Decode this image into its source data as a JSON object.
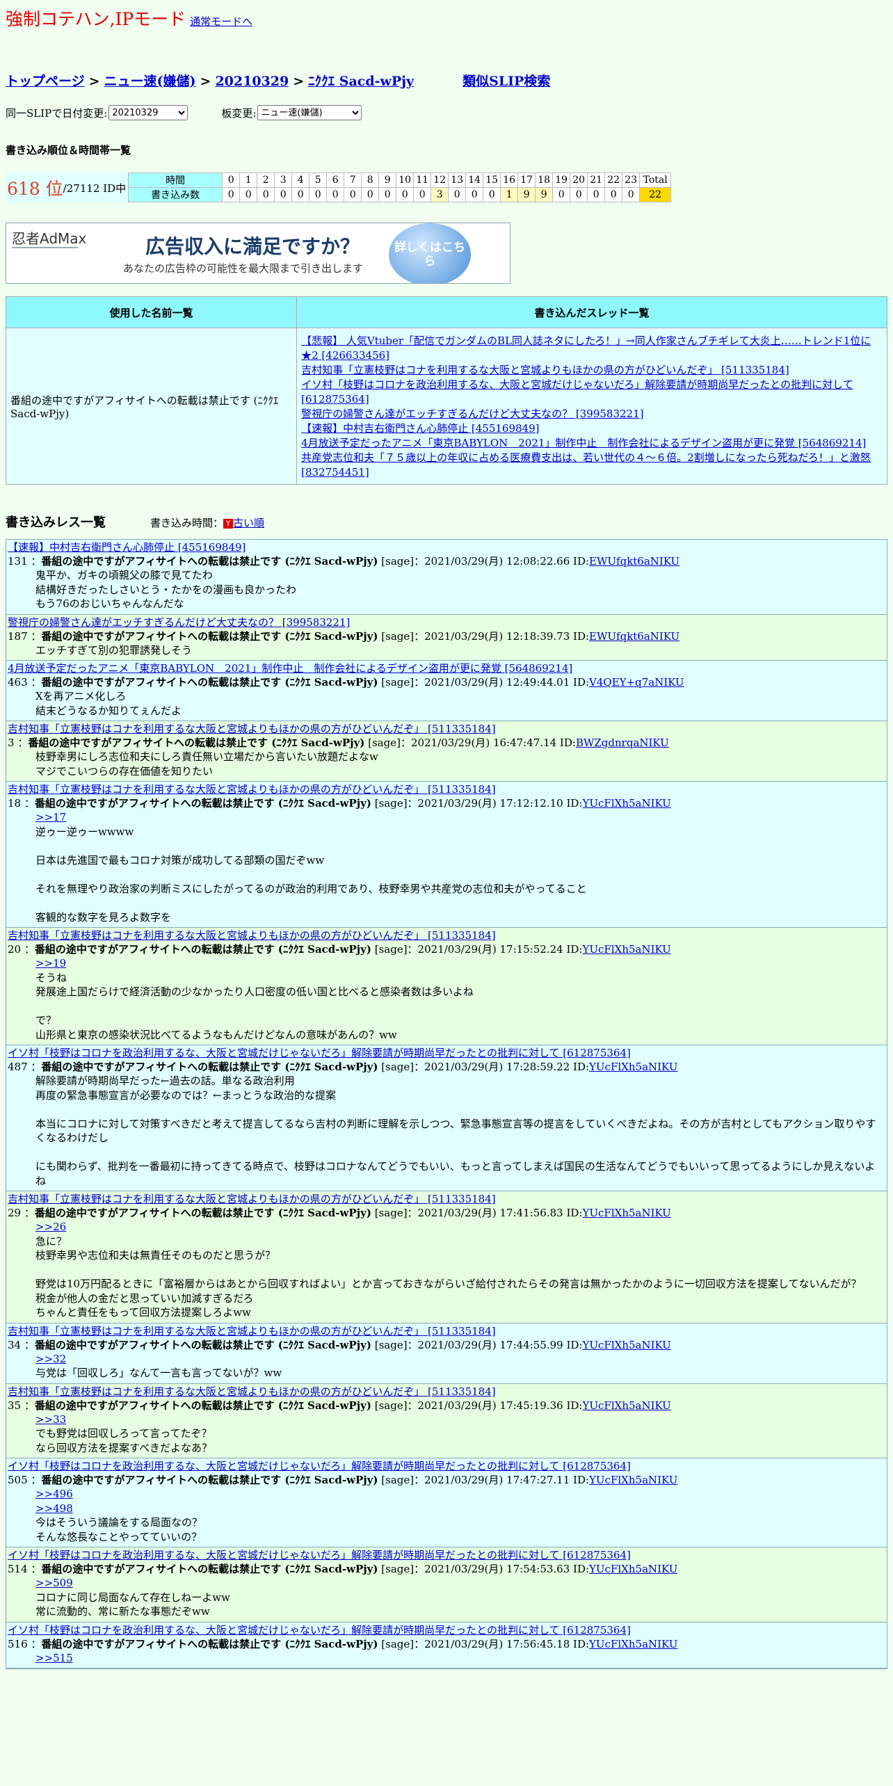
{
  "header": {
    "mode_title": "強制コテハン,IPモード",
    "normal_mode_link": "通常モードへ"
  },
  "breadcrumb": {
    "top": "トップページ",
    "board": "ニュー速(嫌儲)",
    "date": "20210329",
    "slip": "ﾆｸｸｴ Sacd-wPjy",
    "similar": "類似SLIP検索",
    "sep": ">"
  },
  "selectors": {
    "date_label": "同一SLIPで日付変更:",
    "date_value": "20210329",
    "board_label": "板変更:",
    "board_value": "ニュー速(嫌儲)"
  },
  "ranking": {
    "heading": "書き込み順位＆時間帯一覧",
    "rank": "618 位",
    "total_ids": "/27112 ID中",
    "time_label": "時間",
    "count_label": "書き込み数",
    "hours": [
      "0",
      "1",
      "2",
      "3",
      "4",
      "5",
      "6",
      "7",
      "8",
      "9",
      "10",
      "11",
      "12",
      "13",
      "14",
      "15",
      "16",
      "17",
      "18",
      "19",
      "20",
      "21",
      "22",
      "23"
    ],
    "counts": [
      "0",
      "0",
      "0",
      "0",
      "0",
      "0",
      "0",
      "0",
      "0",
      "0",
      "0",
      "0",
      "3",
      "0",
      "0",
      "0",
      "1",
      "9",
      "9",
      "0",
      "0",
      "0",
      "0",
      "0"
    ],
    "total_label": "Total",
    "total_value": "22"
  },
  "ad": {
    "logo": "忍者AdMax",
    "main": "広告収入に満足ですか？",
    "sub": "あなたの広告枠の可能性を最大限まで引き出します",
    "button": "詳しくはこちら"
  },
  "names_table": {
    "col1": "使用した名前一覧",
    "col2": "書き込んだスレッド一覧",
    "name": "番組の途中ですがアフィサイトへの転載は禁止です (ﾆｸｸｴ Sacd-wPjy)",
    "threads": [
      "【悲報】 人気Vtuber「配信でガンダムのBL同人誌ネタにしたろ！」→同人作家さんブチギレて大炎上……トレンド1位に★2 [426633456]",
      "吉村知事「立憲枝野はコナを利用するな大阪と宮城よりもほかの県の方がひどいんだぞ」 [511335184]",
      "イソ村「枝野はコロナを政治利用するな、大阪と宮城だけじゃないだろ」解除要請が時期尚早だったとの批判に対して [612875364]",
      "警視庁の婦警さん達がエッチすぎるんだけど大丈夫なの？ [399583221]",
      "【速報】中村吉右衛門さん心肺停止 [455169849]",
      "4月放送予定だったアニメ「東京BABYLON　2021」制作中止　制作会社によるデザイン盗用が更に発覚 [564869214]",
      "共産党志位和夫「７５歳以上の年収に占める医療費支出は、若い世代の４～６倍。2割増しになったら死ねだろ！」と激怒 [832754451]"
    ]
  },
  "posts_header": {
    "title": "書き込みレス一覧",
    "time_label": "書き込み時間：",
    "order_icon": "Y",
    "order_link": "古い順"
  },
  "posts": [
    {
      "thread": "【速報】中村吉右衛門さん心肺停止 [455169849]",
      "num": "131",
      "name": "番組の途中ですがアフィサイトへの転載は禁止です (ﾆｸｸｴ Sacd-wPjy)",
      "meta": "[sage]：2021/03/29(月) 12:08:22.66 ID:",
      "id": "EWUfqkt6aNIKU",
      "lines": [
        "鬼平か、ガキの頃親父の膝で見てたわ",
        "結構好きだったしさいとう・たかをの漫画も良かったわ",
        "もう76のおじいちゃんなんだな"
      ]
    },
    {
      "thread": "警視庁の婦警さん達がエッチすぎるんだけど大丈夫なの？ [399583221]",
      "num": "187",
      "name": "番組の途中ですがアフィサイトへの転載は禁止です (ﾆｸｸｴ Sacd-wPjy)",
      "meta": "[sage]：2021/03/29(月) 12:18:39.73 ID:",
      "id": "EWUfqkt6aNIKU",
      "lines": [
        "エッチすぎて別の犯罪誘発しそう"
      ]
    },
    {
      "thread": "4月放送予定だったアニメ「東京BABYLON　2021」制作中止　制作会社によるデザイン盗用が更に発覚 [564869214]",
      "num": "463",
      "name": "番組の途中ですがアフィサイトへの転載は禁止です (ﾆｸｸｴ Sacd-wPjy)",
      "meta": "[sage]：2021/03/29(月) 12:49:44.01 ID:",
      "id": "V4QEY+q7aNIKU",
      "lines": [
        "Xを再アニメ化しろ",
        "結末どうなるか知りてぇんだよ"
      ]
    },
    {
      "thread": "吉村知事「立憲枝野はコナを利用するな大阪と宮城よりもほかの県の方がひどいんだぞ」 [511335184]",
      "num": "3",
      "name": "番組の途中ですがアフィサイトへの転載は禁止です (ﾆｸｸｴ Sacd-wPjy)",
      "meta": "[sage]：2021/03/29(月) 16:47:47.14 ID:",
      "id": "BWZgdnrqaNIKU",
      "lines": [
        "枝野幸男にしろ志位和夫にしろ責任無い立場だから言いたい放題だよなw",
        "マジでこいつらの存在価値を知りたい"
      ]
    },
    {
      "thread": "吉村知事「立憲枝野はコナを利用するな大阪と宮城よりもほかの県の方がひどいんだぞ」 [511335184]",
      "num": "18",
      "name": "番組の途中ですがアフィサイトへの転載は禁止です (ﾆｸｸｴ Sacd-wPjy)",
      "meta": "[sage]：2021/03/29(月) 17:12:12.10 ID:",
      "id": "YUcFlXh5aNIKU",
      "anchors": [
        ">>17"
      ],
      "lines": [
        "逆ゥー逆ゥーwwww",
        "",
        "日本は先進国で最もコロナ対策が成功してる部類の国だぞww",
        "",
        "それを無理やり政治家の判断ミスにしたがってるのが政治的利用であり、枝野幸男や共産党の志位和夫がやってること",
        "",
        "客観的な数字を見ろよ数字を"
      ]
    },
    {
      "thread": "吉村知事「立憲枝野はコナを利用するな大阪と宮城よりもほかの県の方がひどいんだぞ」 [511335184]",
      "num": "20",
      "name": "番組の途中ですがアフィサイトへの転載は禁止です (ﾆｸｸｴ Sacd-wPjy)",
      "meta": "[sage]：2021/03/29(月) 17:15:52.24 ID:",
      "id": "YUcFlXh5aNIKU",
      "anchors": [
        ">>19"
      ],
      "lines": [
        "そうね",
        "発展途上国だらけで経済活動の少なかったり人口密度の低い国と比べると感染者数は多いよね",
        "",
        "で？",
        "山形県と東京の感染状況比べてるようなもんだけどなんの意味があんの？ww"
      ]
    },
    {
      "thread": "イソ村「枝野はコロナを政治利用するな、大阪と宮城だけじゃないだろ」解除要請が時期尚早だったとの批判に対して [612875364]",
      "num": "487",
      "name": "番組の途中ですがアフィサイトへの転載は禁止です (ﾆｸｸｴ Sacd-wPjy)",
      "meta": "[sage]：2021/03/29(月) 17:28:59.22 ID:",
      "id": "YUcFlXh5aNIKU",
      "lines": [
        "解除要請が時期尚早だった←過去の話。単なる政治利用",
        "再度の緊急事態宣言が必要なのでは？←まっとうな政治的な提案",
        "",
        "本当にコロナに対して対策すべきだと考えて提言してるなら吉村の判断に理解を示しつつ、緊急事態宣言等の提言をしていくべきだよね。その方が吉村としてもアクション取りやすくなるわけだし",
        "",
        "にも関わらず、批判を一番最初に持ってきてる時点で、枝野はコロナなんてどうでもいい、もっと言ってしまえば国民の生活なんてどうでもいいって思ってるようにしか見えないよね"
      ]
    },
    {
      "thread": "吉村知事「立憲枝野はコナを利用するな大阪と宮城よりもほかの県の方がひどいんだぞ」 [511335184]",
      "num": "29",
      "name": "番組の途中ですがアフィサイトへの転載は禁止です (ﾆｸｸｴ Sacd-wPjy)",
      "meta": "[sage]：2021/03/29(月) 17:41:56.83 ID:",
      "id": "YUcFlXh5aNIKU",
      "anchors": [
        ">>26"
      ],
      "lines": [
        "急に？",
        "枝野幸男や志位和夫は無責任そのものだと思うが？",
        "",
        "野党は10万円配るときに「富裕層からはあとから回収すればよい」とか言っておきながらいざ給付されたらその発言は無かったかのように一切回収方法を提案してないんだが？",
        "税金が他人の金だと思っていい加減すぎるだろ",
        "ちゃんと責任をもって回収方法提案しろよww"
      ]
    },
    {
      "thread": "吉村知事「立憲枝野はコナを利用するな大阪と宮城よりもほかの県の方がひどいんだぞ」 [511335184]",
      "num": "34",
      "name": "番組の途中ですがアフィサイトへの転載は禁止です (ﾆｸｸｴ Sacd-wPjy)",
      "meta": "[sage]：2021/03/29(月) 17:44:55.99 ID:",
      "id": "YUcFlXh5aNIKU",
      "anchors": [
        ">>32"
      ],
      "lines": [
        "与党は「回収しろ」なんて一言も言ってないが？ww"
      ]
    },
    {
      "thread": "吉村知事「立憲枝野はコナを利用するな大阪と宮城よりもほかの県の方がひどいんだぞ」 [511335184]",
      "num": "35",
      "name": "番組の途中ですがアフィサイトへの転載は禁止です (ﾆｸｸｴ Sacd-wPjy)",
      "meta": "[sage]：2021/03/29(月) 17:45:19.36 ID:",
      "id": "YUcFlXh5aNIKU",
      "anchors": [
        ">>33"
      ],
      "lines": [
        "でも野党は回収しろって言ってたぞ？",
        "なら回収方法を提案すべきだよなあ？"
      ]
    },
    {
      "thread": "イソ村「枝野はコロナを政治利用するな、大阪と宮城だけじゃないだろ」解除要請が時期尚早だったとの批判に対して [612875364]",
      "num": "505",
      "name": "番組の途中ですがアフィサイトへの転載は禁止です (ﾆｸｸｴ Sacd-wPjy)",
      "meta": "[sage]：2021/03/29(月) 17:47:27.11 ID:",
      "id": "YUcFlXh5aNIKU",
      "anchors": [
        ">>496",
        ">>498"
      ],
      "lines": [
        "今はそういう議論をする局面なの？",
        "そんな悠長なことやってていいの？"
      ]
    },
    {
      "thread": "イソ村「枝野はコロナを政治利用するな、大阪と宮城だけじゃないだろ」解除要請が時期尚早だったとの批判に対して [612875364]",
      "num": "514",
      "name": "番組の途中ですがアフィサイトへの転載は禁止です (ﾆｸｸｴ Sacd-wPjy)",
      "meta": "[sage]：2021/03/29(月) 17:54:53.63 ID:",
      "id": "YUcFlXh5aNIKU",
      "anchors": [
        ">>509"
      ],
      "lines": [
        "コロナに同じ局面なんて存在しねーよww",
        "常に流動的、常に新たな事態だぞww"
      ]
    },
    {
      "thread": "イソ村「枝野はコロナを政治利用するな、大阪と宮城だけじゃないだろ」解除要請が時期尚早だったとの批判に対して [612875364]",
      "num": "516",
      "name": "番組の途中ですがアフィサイトへの転載は禁止です (ﾆｸｸｴ Sacd-wPjy)",
      "meta": "[sage]：2021/03/29(月) 17:56:45.18 ID:",
      "id": "YUcFlXh5aNIKU",
      "anchors": [
        ">>515"
      ],
      "lines": []
    }
  ]
}
